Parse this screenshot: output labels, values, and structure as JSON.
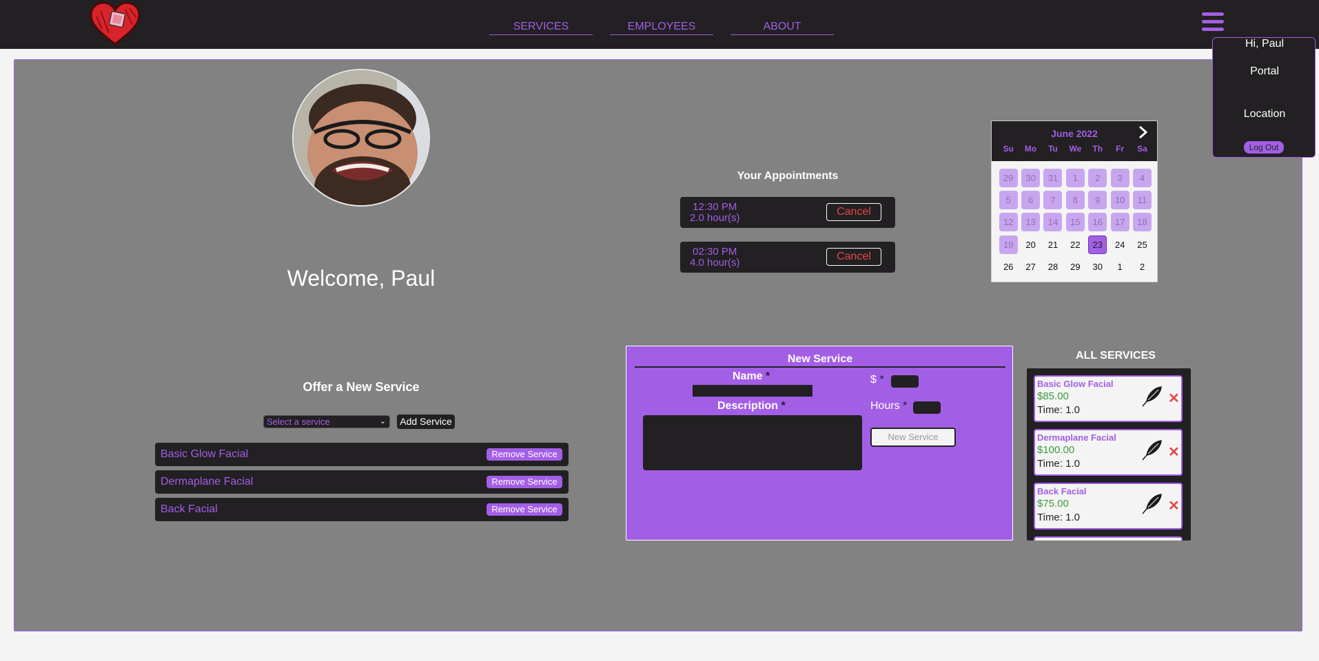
{
  "nav": {
    "items": [
      "SERVICES",
      "EMPLOYEES",
      "ABOUT"
    ]
  },
  "user_menu": {
    "greeting": "Hi, Paul",
    "items": [
      "Portal",
      "Location"
    ],
    "logout_label": "Log Out"
  },
  "profile": {
    "welcome": "Welcome, Paul"
  },
  "appointments": {
    "title": "Your Appointments",
    "items": [
      {
        "time": "12:30 PM",
        "duration": "2.0 hour(s)",
        "cancel_label": "Cancel"
      },
      {
        "time": "02:30 PM",
        "duration": "4.0 hour(s)",
        "cancel_label": "Cancel"
      }
    ]
  },
  "calendar": {
    "month_label": "June 2022",
    "next_icon": "chevron-right-icon",
    "weekdays": [
      "Su",
      "Mo",
      "Tu",
      "We",
      "Th",
      "Fr",
      "Sa"
    ],
    "days": [
      {
        "n": "29",
        "state": "disabled"
      },
      {
        "n": "30",
        "state": "disabled"
      },
      {
        "n": "31",
        "state": "disabled"
      },
      {
        "n": "1",
        "state": "disabled"
      },
      {
        "n": "2",
        "state": "disabled"
      },
      {
        "n": "3",
        "state": "disabled"
      },
      {
        "n": "4",
        "state": "disabled"
      },
      {
        "n": "5",
        "state": "disabled"
      },
      {
        "n": "6",
        "state": "disabled"
      },
      {
        "n": "7",
        "state": "disabled"
      },
      {
        "n": "8",
        "state": "disabled"
      },
      {
        "n": "9",
        "state": "disabled"
      },
      {
        "n": "10",
        "state": "disabled"
      },
      {
        "n": "11",
        "state": "disabled"
      },
      {
        "n": "12",
        "state": "disabled"
      },
      {
        "n": "13",
        "state": "disabled"
      },
      {
        "n": "14",
        "state": "disabled"
      },
      {
        "n": "15",
        "state": "disabled"
      },
      {
        "n": "16",
        "state": "disabled"
      },
      {
        "n": "17",
        "state": "disabled"
      },
      {
        "n": "18",
        "state": "disabled"
      },
      {
        "n": "19",
        "state": "disabled"
      },
      {
        "n": "20",
        "state": "enabled"
      },
      {
        "n": "21",
        "state": "enabled"
      },
      {
        "n": "22",
        "state": "enabled"
      },
      {
        "n": "23",
        "state": "selected"
      },
      {
        "n": "24",
        "state": "enabled"
      },
      {
        "n": "25",
        "state": "enabled"
      },
      {
        "n": "26",
        "state": "enabled"
      },
      {
        "n": "27",
        "state": "enabled"
      },
      {
        "n": "28",
        "state": "enabled"
      },
      {
        "n": "29",
        "state": "enabled"
      },
      {
        "n": "30",
        "state": "enabled"
      },
      {
        "n": "1",
        "state": "enabled"
      },
      {
        "n": "2",
        "state": "enabled"
      }
    ]
  },
  "offer": {
    "title": "Offer a New Service",
    "select_placeholder": "Select a service",
    "add_label": "Add Service",
    "services": [
      {
        "name": "Basic Glow Facial",
        "remove_label": "Remove Service"
      },
      {
        "name": "Dermaplane Facial",
        "remove_label": "Remove Service"
      },
      {
        "name": "Back Facial",
        "remove_label": "Remove Service"
      }
    ]
  },
  "new_service": {
    "title": "New Service",
    "name_label": "Name",
    "description_label": "Description",
    "price_label": "$",
    "hours_label": "Hours",
    "required_mark": "*",
    "submit_label": "New Service"
  },
  "all_services": {
    "title": "ALL SERVICES",
    "time_prefix": "Time:",
    "items": [
      {
        "name": "Basic Glow Facial",
        "price": "$85.00",
        "time": "1.0"
      },
      {
        "name": "Dermaplane Facial",
        "price": "$100.00",
        "time": "1.0"
      },
      {
        "name": "Back Facial",
        "price": "$75.00",
        "time": "1.0"
      }
    ]
  },
  "colors": {
    "accent": "#a35ee6",
    "dark": "#222022",
    "panel": "#828282",
    "danger": "#e24848",
    "price": "#3c9a3c"
  }
}
